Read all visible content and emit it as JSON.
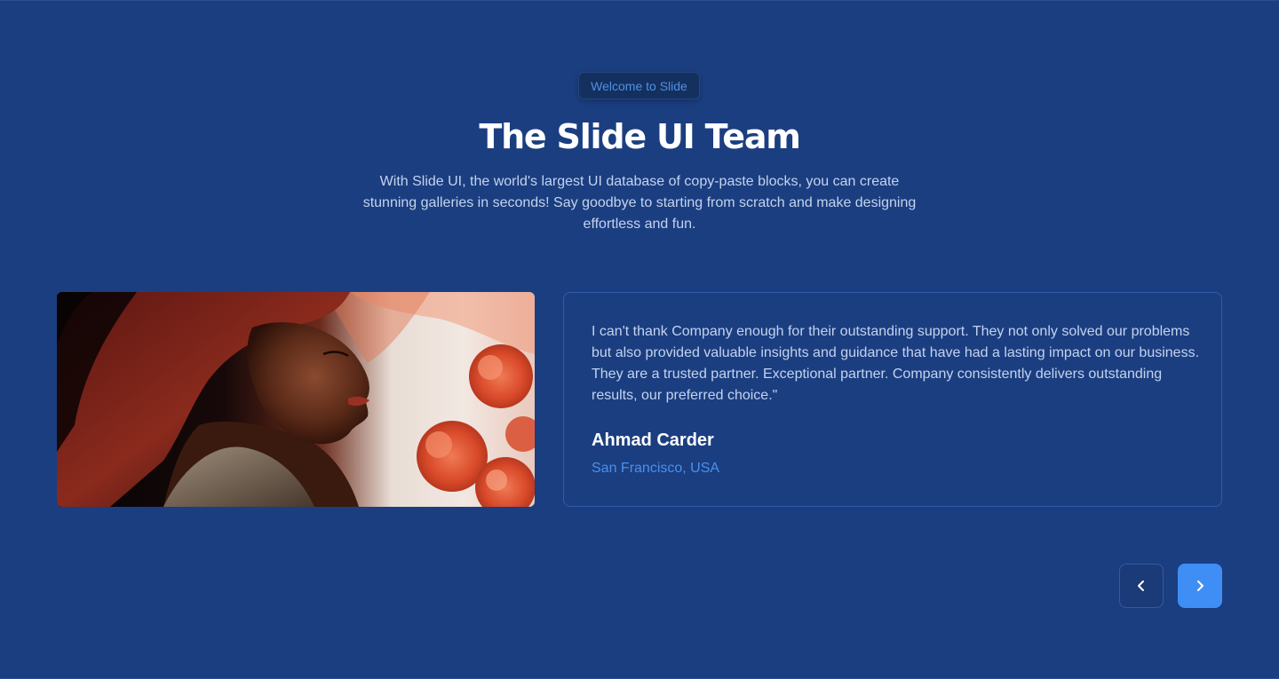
{
  "header": {
    "badge": "Welcome to Slide",
    "title": "The Slide UI Team",
    "subtitle": "With Slide UI, the world's largest UI database of copy-paste blocks, you can create stunning galleries in seconds! Say goodbye to starting from scratch and make designing effortless and fun."
  },
  "testimonial": {
    "quote": "I can't thank Company enough for their outstanding support. They not only solved our problems but also provided valuable insights and guidance that have had a lasting impact on our business. They are a trusted partner. Exceptional partner. Company consistently delivers outstanding results, our preferred choice.\"",
    "author_name": "Ahmad Carder",
    "author_location": "San Francisco, USA"
  },
  "navigation": {
    "prev_icon": "chevron-left-icon",
    "next_icon": "chevron-right-icon"
  },
  "colors": {
    "background": "#1b3e80",
    "accent": "#3f8ef5",
    "location_text": "#4a90ec",
    "card_border": "#2f5bab"
  }
}
